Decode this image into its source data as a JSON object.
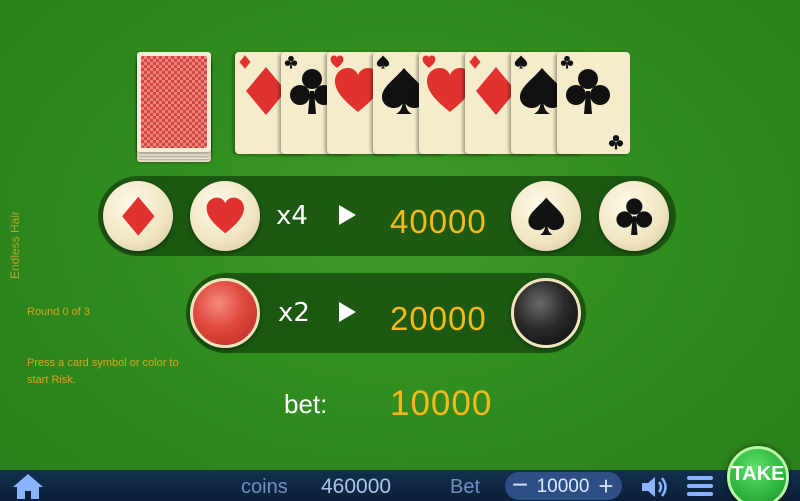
{
  "game": {
    "title": "Endless Hair"
  },
  "status": {
    "round": "Round 0 of 3",
    "instruction": "Press a card symbol or color to start Risk."
  },
  "history_cards": [
    {
      "suit": "diamond",
      "color": "#e0322f"
    },
    {
      "suit": "club",
      "color": "#111111"
    },
    {
      "suit": "heart",
      "color": "#e0322f"
    },
    {
      "suit": "spade",
      "color": "#111111"
    },
    {
      "suit": "heart",
      "color": "#e0322f"
    },
    {
      "suit": "diamond",
      "color": "#e0322f"
    },
    {
      "suit": "spade",
      "color": "#111111"
    },
    {
      "suit": "club",
      "color": "#111111"
    }
  ],
  "suit_row": {
    "multiplier": "x4",
    "arrow": "▶",
    "win": "40000",
    "options": [
      "diamond",
      "heart",
      "spade",
      "club"
    ]
  },
  "color_row": {
    "multiplier": "x2",
    "arrow": "▶",
    "win": "20000",
    "options": [
      "red",
      "black"
    ]
  },
  "current_bet": {
    "label": "bet:",
    "value": "10000"
  },
  "bottom_bar": {
    "coins_label": "coins",
    "coins_value": "460000",
    "bet_label": "Bet",
    "bet_value": "10000",
    "minus": "−",
    "plus": "+",
    "take_label": "TAKE"
  },
  "colors": {
    "accent": "#f7b81c",
    "table": "#2f8a1e",
    "red": "#e0322f"
  }
}
